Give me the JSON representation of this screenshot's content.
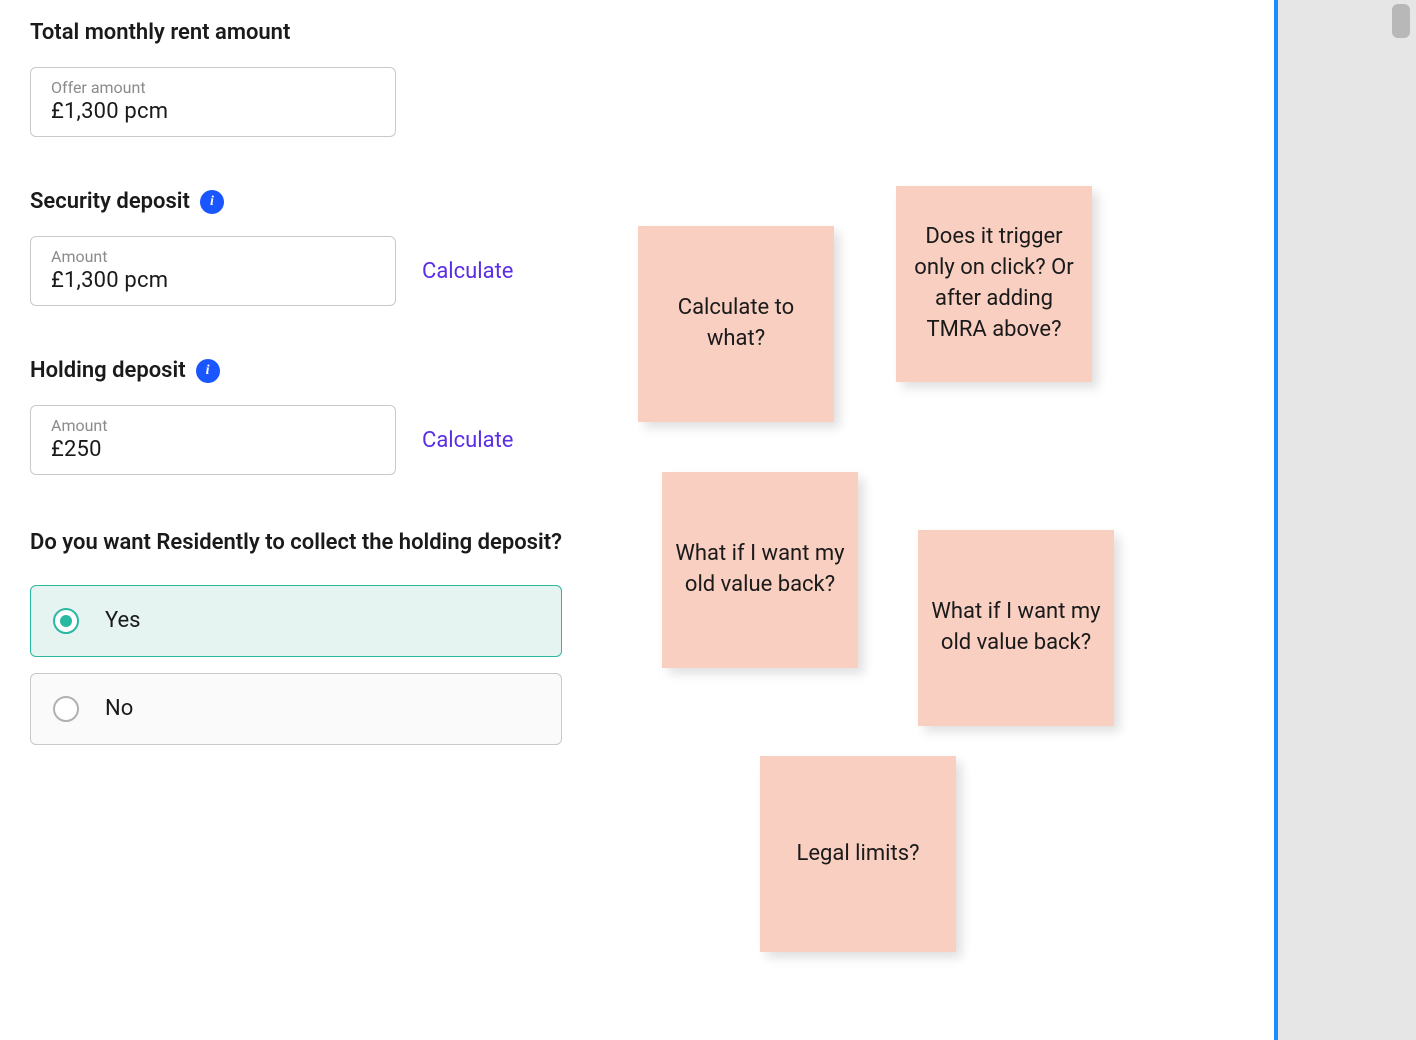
{
  "form": {
    "rent": {
      "heading": "Total monthly rent amount",
      "label": "Offer amount",
      "value": "£1,300 pcm"
    },
    "security": {
      "heading": "Security deposit",
      "label": "Amount",
      "value": "£1,300 pcm",
      "calculate": "Calculate"
    },
    "holding": {
      "heading": "Holding deposit",
      "label": "Amount",
      "value": "£250",
      "calculate": "Calculate"
    },
    "collect_question": {
      "text": "Do you want Residently to collect the holding deposit?",
      "yes": "Yes",
      "no": "No",
      "selected": "yes"
    }
  },
  "stickies": {
    "s1": "Calculate to what?",
    "s2": "Does it trigger only on click? Or after adding TMRA above?",
    "s3": "What if I want my old value back?",
    "s4": "What if I want my old value back?",
    "s5": "Legal limits?"
  }
}
